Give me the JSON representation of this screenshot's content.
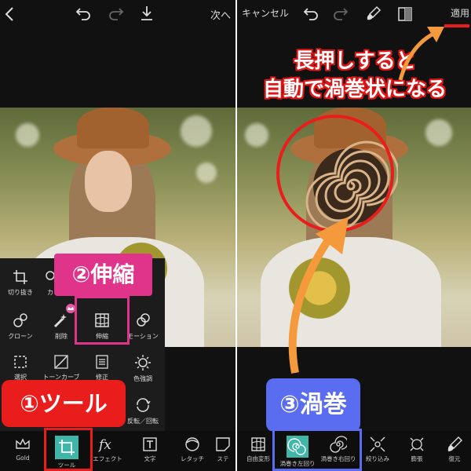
{
  "left_panel": {
    "header": {
      "next_label": "次へ"
    },
    "tools": [
      {
        "label": "切り抜き",
        "icon": "crop-icon"
      },
      {
        "label": "カ",
        "icon": "cutout-icon"
      },
      {
        "label": "クローン",
        "icon": "clone-icon"
      },
      {
        "label": "削除",
        "icon": "remove-icon"
      },
      {
        "label": "伸縮",
        "icon": "stretch-icon"
      },
      {
        "label": "モーション",
        "icon": "motion-icon"
      },
      {
        "label": "選択",
        "icon": "select-icon"
      },
      {
        "label": "トーンカーブ",
        "icon": "curves-icon"
      },
      {
        "label": "修正",
        "icon": "adjust-icon"
      },
      {
        "label": "色強調",
        "icon": "color-enhance-icon"
      },
      {
        "label": "反転／回転",
        "icon": "flip-rotate-icon"
      }
    ],
    "bottom_nav": [
      {
        "label": "Gold",
        "icon": "crown-icon"
      },
      {
        "label": "ツール",
        "icon": "crop-tool-icon"
      },
      {
        "label": "エフェクト",
        "icon": "fx-icon"
      },
      {
        "label": "文字",
        "icon": "text-icon"
      },
      {
        "label": "レタッチ",
        "icon": "retouch-icon"
      },
      {
        "label": "ステ",
        "icon": "sticker-icon"
      }
    ],
    "callout_tools": "①ツール",
    "callout_stretch": "②伸縮"
  },
  "right_panel": {
    "header": {
      "cancel_label": "キャンセル",
      "apply_label": "適用"
    },
    "annotation": {
      "line1": "長押しすると",
      "line2": "自動で渦巻状になる"
    },
    "callout_swirl": "③渦巻",
    "bottom_tools": [
      {
        "label": "自由変形",
        "icon": "free-warp-icon"
      },
      {
        "label": "渦巻き左回り",
        "icon": "swirl-left-icon"
      },
      {
        "label": "渦巻き右回り",
        "icon": "swirl-right-icon"
      },
      {
        "label": "絞り込み",
        "icon": "pinch-icon"
      },
      {
        "label": "膨張",
        "icon": "bloat-icon"
      },
      {
        "label": "復元",
        "icon": "restore-icon"
      }
    ]
  },
  "colors": {
    "accent_red": "#ea1d1d",
    "callout_pink": "#e0338a",
    "callout_blue": "#5a6cf0",
    "arrow_orange": "#f59a3c",
    "active_teal": "#3fb6a8"
  }
}
